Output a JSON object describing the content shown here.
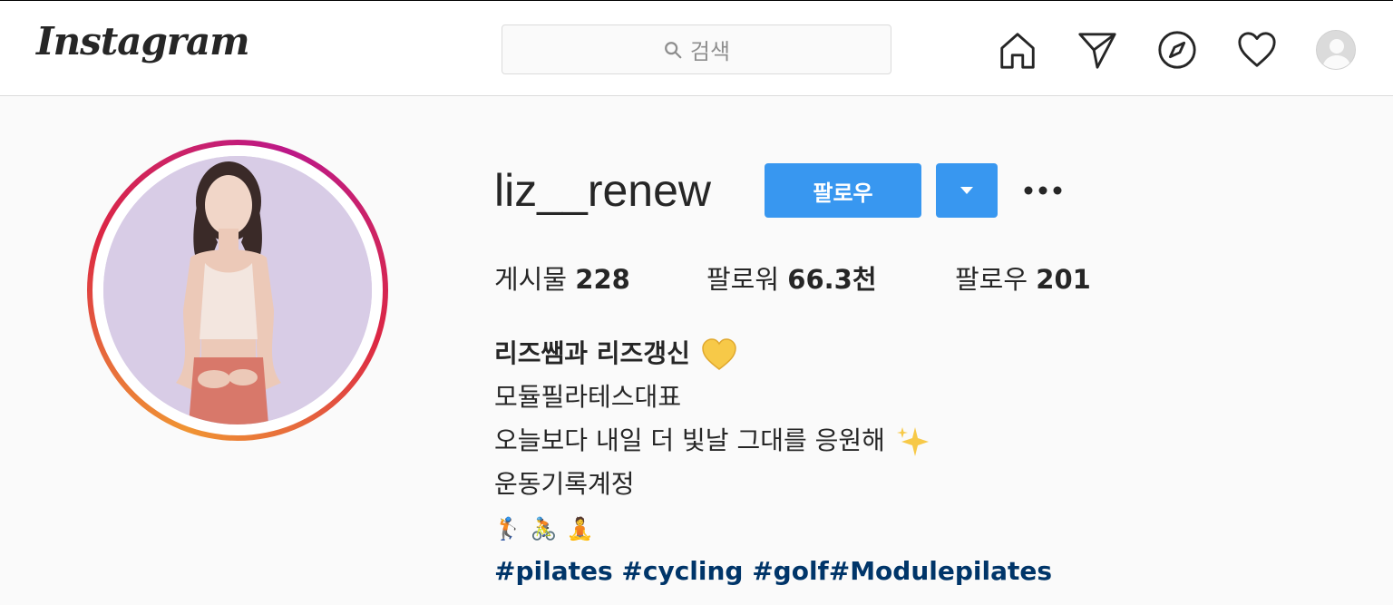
{
  "header": {
    "logo_text": "Instagram",
    "search_placeholder": "검색",
    "icons": [
      "home-icon",
      "direct-send-icon",
      "explore-compass-icon",
      "activity-heart-icon",
      "profile-avatar"
    ]
  },
  "profile": {
    "username": "liz__renew",
    "follow_label": "팔로우",
    "stats": [
      {
        "label": "게시물",
        "value": "228"
      },
      {
        "label": "팔로워",
        "value": "66.3천"
      },
      {
        "label": "팔로우",
        "value": "201"
      }
    ],
    "bio": {
      "name": "리즈쌤과 리즈갱신",
      "line2": "모듈필라테스대표",
      "line3": "오늘보다 내일 더 빛날 그대를 응원해",
      "line4": "운동기록계정",
      "activity_emojis": "🏌🚴🧘",
      "hashtags": "#pilates #cycling #golf#Modulepilates"
    }
  },
  "colors": {
    "accent": "#3897f0",
    "hashtag": "#003569",
    "text": "#262626",
    "muted": "#8e8e8e"
  }
}
